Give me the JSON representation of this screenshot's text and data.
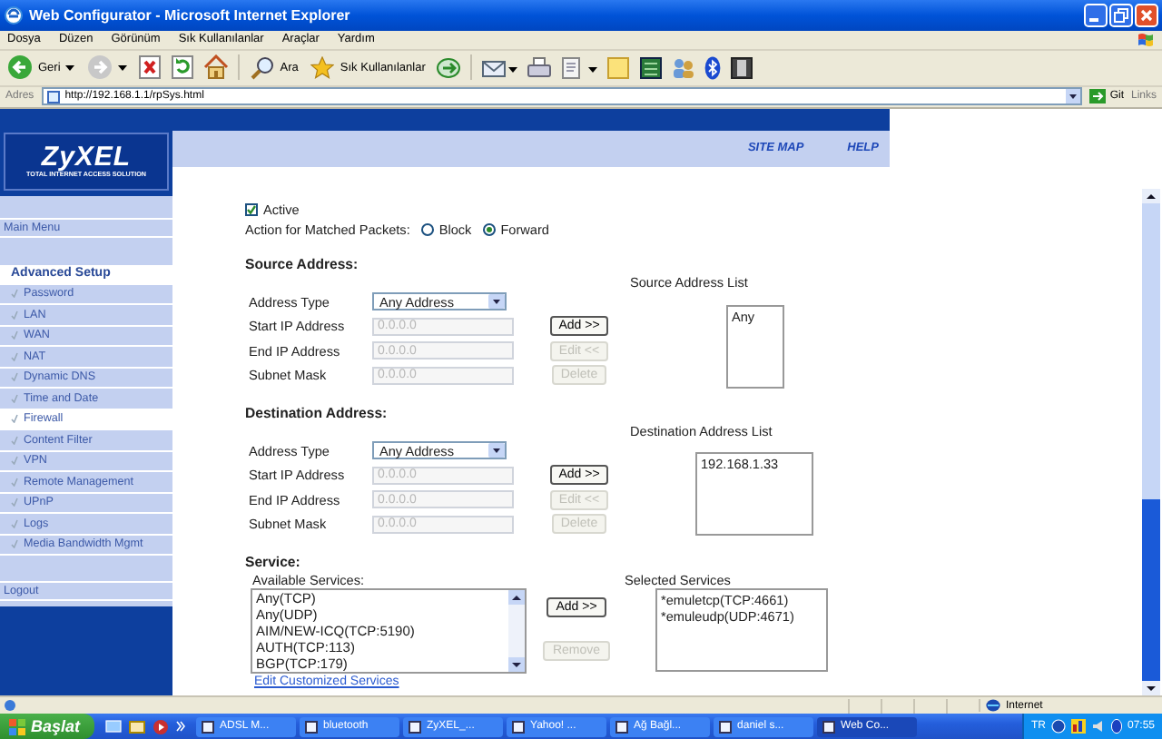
{
  "window": {
    "title": "Web Configurator - Microsoft Internet Explorer"
  },
  "menu": [
    "Dosya",
    "Düzen",
    "Görünüm",
    "Sık Kullanılanlar",
    "Araçlar",
    "Yardım"
  ],
  "toolbar": {
    "back": "Geri",
    "search": "Ara",
    "favorites": "Sık Kullanılanlar"
  },
  "address_bar": {
    "label": "Adres",
    "value": "http://192.168.1.1/rpSys.html",
    "go": "Git",
    "links": "Links"
  },
  "header": {
    "logo": "ZyXEL",
    "tagline": "TOTAL INTERNET ACCESS SOLUTION",
    "links": [
      "SITE MAP",
      "HELP"
    ]
  },
  "sidebar": {
    "items": [
      {
        "label": "Main Menu",
        "kind": "top",
        "selected": false
      },
      {
        "label": "Advanced Setup",
        "kind": "section",
        "selected": true
      },
      {
        "label": "Password",
        "kind": "sub",
        "selected": false
      },
      {
        "label": "LAN",
        "kind": "sub",
        "selected": false
      },
      {
        "label": "WAN",
        "kind": "sub",
        "selected": false
      },
      {
        "label": "NAT",
        "kind": "sub",
        "selected": false
      },
      {
        "label": "Dynamic DNS",
        "kind": "sub",
        "selected": false
      },
      {
        "label": "Time and Date",
        "kind": "sub",
        "selected": false
      },
      {
        "label": "Firewall",
        "kind": "sub",
        "selected": true
      },
      {
        "label": "Content Filter",
        "kind": "sub",
        "selected": false
      },
      {
        "label": "VPN",
        "kind": "sub",
        "selected": false
      },
      {
        "label": "Remote Management",
        "kind": "sub",
        "selected": false
      },
      {
        "label": "UPnP",
        "kind": "sub",
        "selected": false
      },
      {
        "label": "Logs",
        "kind": "sub",
        "selected": false
      },
      {
        "label": "Media Bandwidth Mgmt",
        "kind": "sub",
        "selected": false
      },
      {
        "label": "Logout",
        "kind": "top",
        "selected": false
      }
    ]
  },
  "form": {
    "active": {
      "label": "Active",
      "checked": true
    },
    "action": {
      "label": "Action for Matched Packets:",
      "options": [
        {
          "label": "Block",
          "selected": false
        },
        {
          "label": "Forward",
          "selected": true
        }
      ]
    },
    "sections": [
      {
        "heading": "Source Address:",
        "list_label": "Source Address List",
        "rows": [
          {
            "label": "Address Type",
            "kind": "select",
            "value": "Any Address"
          },
          {
            "label": "Start IP Address",
            "kind": "input",
            "value": "0.0.0.0",
            "disabled": true
          },
          {
            "label": "End IP Address",
            "kind": "input",
            "value": "0.0.0.0",
            "disabled": true
          },
          {
            "label": "Subnet Mask",
            "kind": "input",
            "value": "0.0.0.0",
            "disabled": true
          }
        ],
        "buttons": [
          {
            "label": "Add >>",
            "disabled": false
          },
          {
            "label": "Edit <<",
            "disabled": true
          },
          {
            "label": "Delete",
            "disabled": true
          }
        ],
        "list": [
          "Any"
        ]
      },
      {
        "heading": "Destination Address:",
        "list_label": "Destination Address List",
        "rows": [
          {
            "label": "Address Type",
            "kind": "select",
            "value": "Any Address"
          },
          {
            "label": "Start IP Address",
            "kind": "input",
            "value": "0.0.0.0",
            "disabled": true
          },
          {
            "label": "End IP Address",
            "kind": "input",
            "value": "0.0.0.0",
            "disabled": true
          },
          {
            "label": "Subnet Mask",
            "kind": "input",
            "value": "0.0.0.0",
            "disabled": true
          }
        ],
        "buttons": [
          {
            "label": "Add >>",
            "disabled": false
          },
          {
            "label": "Edit <<",
            "disabled": true
          },
          {
            "label": "Delete",
            "disabled": true
          }
        ],
        "list": [
          "192.168.1.33"
        ]
      }
    ],
    "service": {
      "heading": "Service:",
      "available_label": "Available Services:",
      "available": [
        "Any(TCP)",
        "Any(UDP)",
        "AIM/NEW-ICQ(TCP:5190)",
        "AUTH(TCP:113)",
        "BGP(TCP:179)"
      ],
      "buttons": [
        {
          "label": "Add >>",
          "disabled": false
        },
        {
          "label": "Remove",
          "disabled": true
        }
      ],
      "selected_label": "Selected Services",
      "selected": [
        "*emuletcp(TCP:4661)",
        "*emuleudp(UDP:4671)"
      ],
      "link": "Edit Customized Services"
    }
  },
  "status_bar": {
    "zone": "Internet"
  },
  "taskbar": {
    "start": "Başlat",
    "tasks": [
      {
        "label": "ADSL M...",
        "selected": false
      },
      {
        "label": "bluetooth",
        "selected": false
      },
      {
        "label": "ZyXEL_...",
        "selected": false
      },
      {
        "label": "Yahoo! ...",
        "selected": false
      },
      {
        "label": "Ağ Bağl...",
        "selected": false
      },
      {
        "label": "daniel s...",
        "selected": false
      },
      {
        "label": "Web Co...",
        "selected": true
      }
    ],
    "language": "TR",
    "clock": "07:55"
  }
}
